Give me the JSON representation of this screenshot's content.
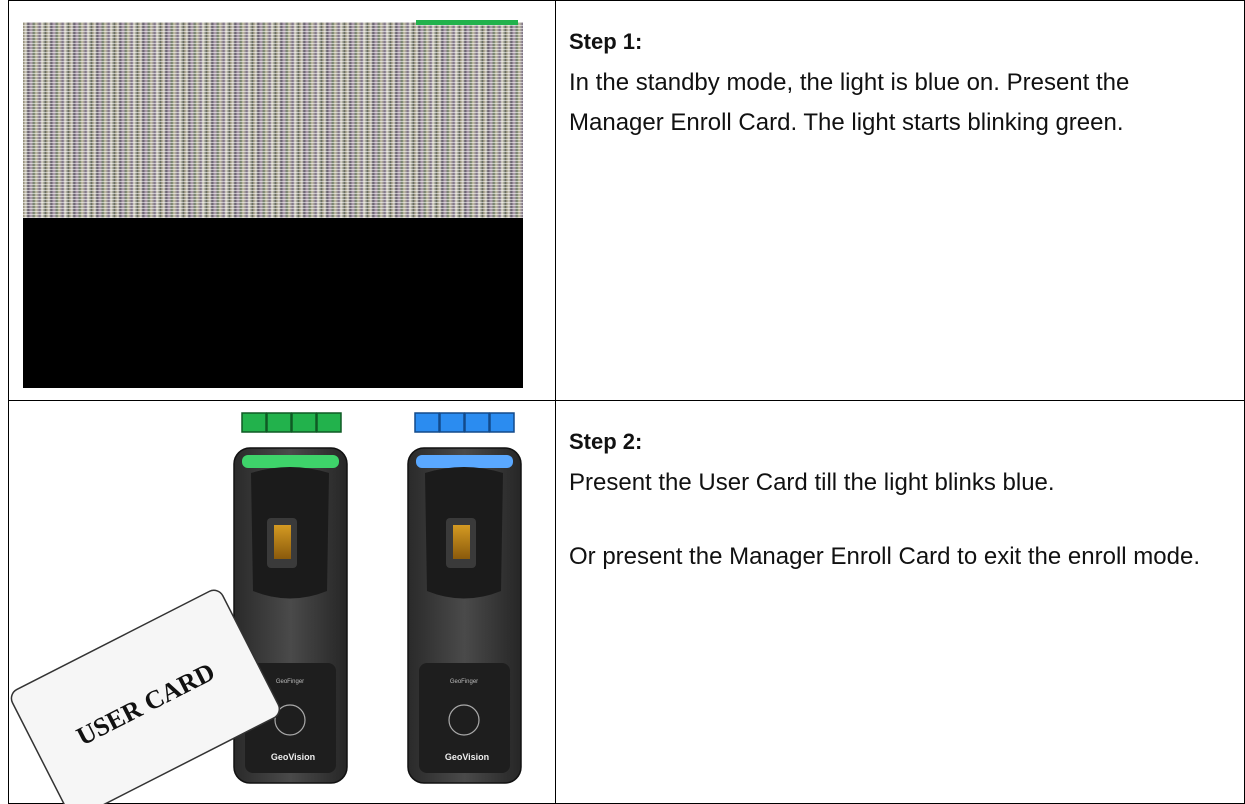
{
  "steps": [
    {
      "heading": "Step 1:",
      "text": "In the standby mode, the light is blue on. Present the Manager Enroll Card. The light starts blinking green."
    },
    {
      "heading": "Step 2:",
      "text": "Present the User Card till the light blinks blue.",
      "text2": "Or present the Manager Enroll Card to exit the enroll mode."
    }
  ],
  "illustration": {
    "card_label": "USER CARD",
    "reader_brand": "GeoFinger",
    "reader_logo": "GeoVision",
    "indicator_left_color": "#22b24c",
    "indicator_right_color": "#2b8cf0"
  }
}
